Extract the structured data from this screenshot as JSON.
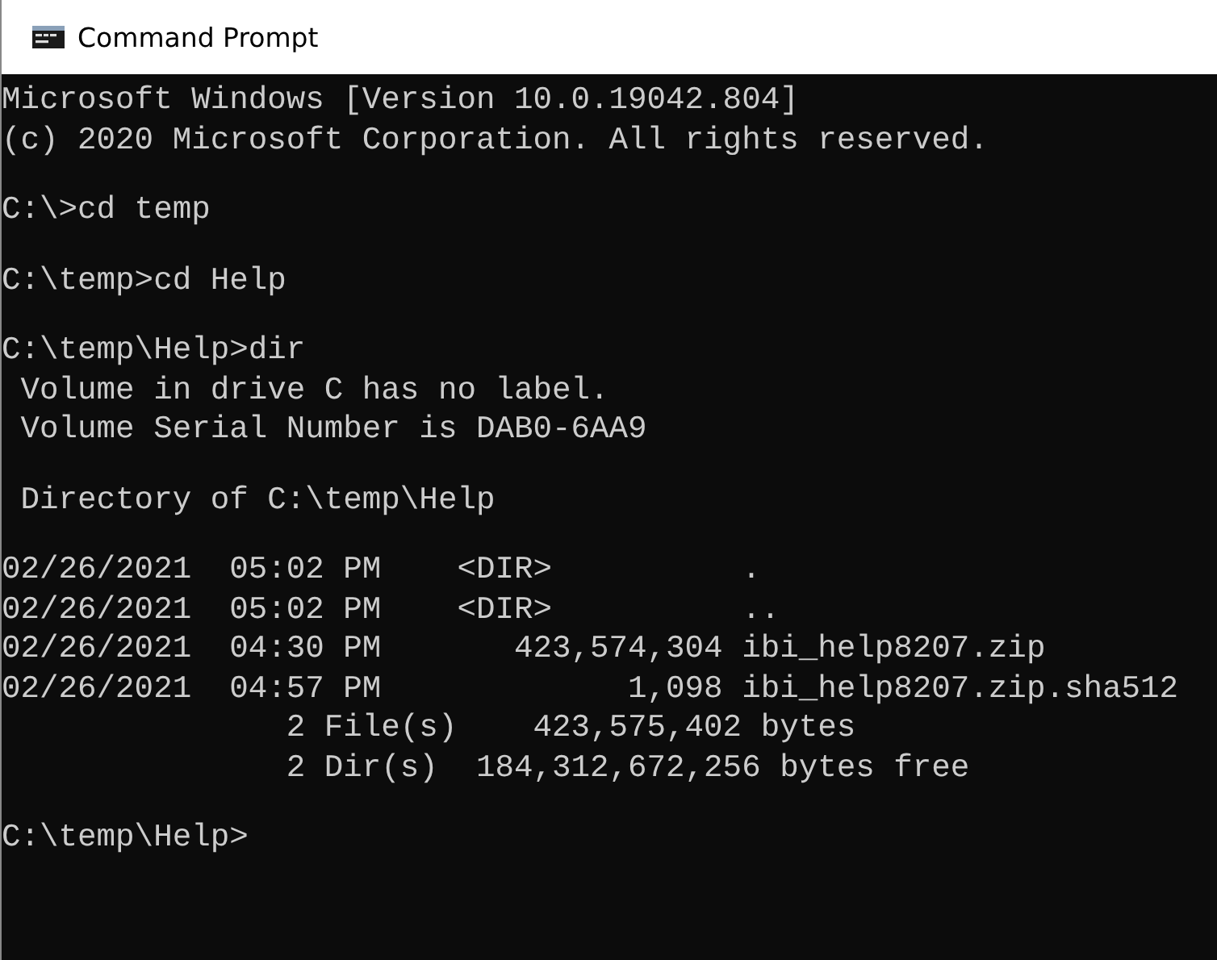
{
  "window": {
    "title": "Command Prompt"
  },
  "console": {
    "blocks": [
      [
        "Microsoft Windows [Version 10.0.19042.804]",
        "(c) 2020 Microsoft Corporation. All rights reserved."
      ],
      [
        "C:\\>cd temp"
      ],
      [
        "C:\\temp>cd Help"
      ],
      [
        "C:\\temp\\Help>dir",
        " Volume in drive C has no label.",
        " Volume Serial Number is DAB0-6AA9"
      ],
      [
        " Directory of C:\\temp\\Help"
      ],
      [
        "02/26/2021  05:02 PM    <DIR>          .",
        "02/26/2021  05:02 PM    <DIR>          ..",
        "02/26/2021  04:30 PM       423,574,304 ibi_help8207.zip",
        "02/26/2021  04:57 PM             1,098 ibi_help8207.zip.sha512",
        "               2 File(s)    423,575,402 bytes",
        "               2 Dir(s)  184,312,672,256 bytes free"
      ],
      [
        "C:\\temp\\Help>"
      ]
    ]
  }
}
